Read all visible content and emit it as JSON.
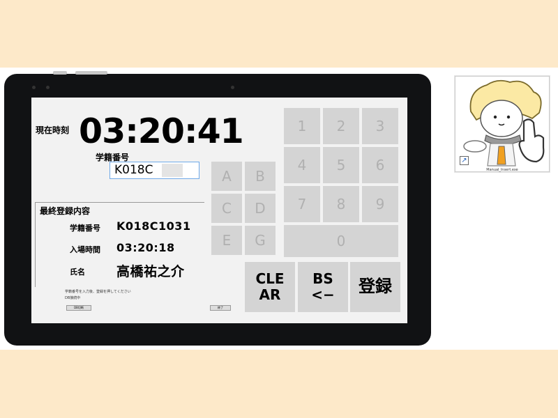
{
  "clock": {
    "label": "現在時刻",
    "time": "03:20:41"
  },
  "input": {
    "label": "学籍番号",
    "value": "K018C"
  },
  "last": {
    "title": "最終登録内容",
    "id_label": "学籍番号",
    "id_value": "K018C1031",
    "time_label": "入場時間",
    "time_value": "03:20:18",
    "name_label": "氏名",
    "name_value": "高橋祐之介"
  },
  "hints": {
    "line1": "学籍番号を入力後、登録を押してください",
    "line2": "DB接続中"
  },
  "small_buttons": {
    "left": "DB切断",
    "right": "終了"
  },
  "letters": [
    "A",
    "B",
    "C",
    "D",
    "E",
    "G"
  ],
  "digits": [
    "1",
    "2",
    "3",
    "4",
    "5",
    "6",
    "7",
    "8",
    "9",
    "0"
  ],
  "actions": {
    "clear": "CLE\nAR",
    "bs": "BS\n<−",
    "register": "登録"
  },
  "desktop_icon": {
    "caption": "Manual_Insert.exe",
    "icon": "mascot-pointing-hand-icon"
  },
  "colors": {
    "background": "#fde9c9",
    "key_disabled": "#d4d4d4",
    "input_border": "#6ea8e8"
  }
}
